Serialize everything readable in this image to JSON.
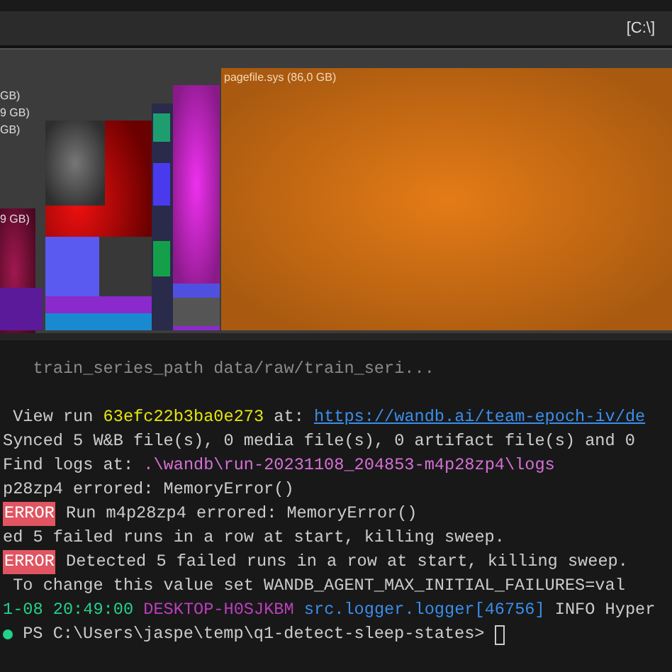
{
  "toolbar": {
    "path_label": "[C:\\]"
  },
  "treemap": {
    "main_label": "pagefile.sys (86,0 GB)",
    "side_labels": [
      "GB)",
      "9 GB)",
      "GB)",
      "9 GB)"
    ]
  },
  "terminal": {
    "top_line": "   train_series_path data/raw/train_seri...",
    "lines": [
      {
        "kind": "output",
        "segments": [
          {
            "kind": "plain",
            "text": " View run "
          },
          {
            "kind": "yellow",
            "text": "63efc22b3ba0e273"
          },
          {
            "kind": "plain",
            "text": " at: "
          },
          {
            "kind": "link",
            "text": "https://wandb.ai/team-epoch-iv/de"
          }
        ]
      },
      {
        "kind": "output",
        "segments": [
          {
            "kind": "plain",
            "text": "Synced 5 W&B file(s), 0 media file(s), 0 artifact file(s) and 0"
          }
        ]
      },
      {
        "kind": "output",
        "segments": [
          {
            "kind": "plain",
            "text": "Find logs at: "
          },
          {
            "kind": "magenta",
            "text": ".\\wandb\\run-20231108_204853-m4p28zp4\\logs"
          }
        ]
      },
      {
        "kind": "output",
        "segments": [
          {
            "kind": "plain",
            "text": "p28zp4 errored: MemoryError()"
          }
        ]
      },
      {
        "kind": "output",
        "segments": [
          {
            "kind": "error",
            "text": "ERROR"
          },
          {
            "kind": "plain",
            "text": " Run m4p28zp4 errored: MemoryError()"
          }
        ]
      },
      {
        "kind": "output",
        "segments": [
          {
            "kind": "plain",
            "text": "ed 5 failed runs in a row at start, killing sweep."
          }
        ]
      },
      {
        "kind": "output",
        "segments": [
          {
            "kind": "error",
            "text": "ERROR"
          },
          {
            "kind": "plain",
            "text": " Detected 5 failed runs in a row at start, killing sweep."
          }
        ]
      },
      {
        "kind": "output",
        "segments": [
          {
            "kind": "plain",
            "text": " To change this value set WANDB_AGENT_MAX_INITIAL_FAILURES=val"
          }
        ]
      },
      {
        "kind": "output",
        "segments": [
          {
            "kind": "green",
            "text": "1-08 20:49:00 "
          },
          {
            "kind": "purple",
            "text": "DESKTOP-H0SJKBM "
          },
          {
            "kind": "blue",
            "text": "src.logger.logger[46756]"
          },
          {
            "kind": "plain",
            "text": " INFO Hyper"
          }
        ]
      },
      {
        "kind": "prompt",
        "segments": [
          {
            "kind": "plain",
            "text": " PS C:\\Users\\jaspe\\temp\\q1-detect-sleep-states> "
          }
        ]
      }
    ]
  }
}
